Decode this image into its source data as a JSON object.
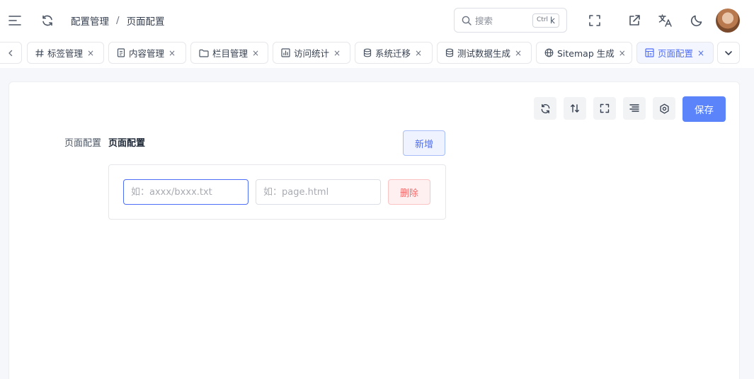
{
  "header": {
    "breadcrumb": [
      "配置管理",
      "页面配置"
    ],
    "breadcrumb_separator": "/",
    "search": {
      "placeholder": "搜索",
      "shortcut_ctrl": "Ctrl",
      "shortcut_key": "k"
    },
    "icons": {
      "menu": "menu-toggle-icon",
      "refresh": "refresh-icon",
      "fullscreen": "fullscreen-icon",
      "external": "external-link-icon",
      "translate": "translate-icon",
      "theme": "moon-icon"
    }
  },
  "tabs": {
    "items": [
      {
        "label": "标签管理",
        "icon": "hash-icon",
        "active": false
      },
      {
        "label": "内容管理",
        "icon": "document-icon",
        "active": false
      },
      {
        "label": "栏目管理",
        "icon": "folder-icon",
        "active": false
      },
      {
        "label": "访问统计",
        "icon": "bar-chart-icon",
        "active": false
      },
      {
        "label": "系统迁移",
        "icon": "database-icon",
        "active": false
      },
      {
        "label": "测试数据生成",
        "icon": "database-icon",
        "active": false
      },
      {
        "label": "Sitemap 生成",
        "icon": "globe-icon",
        "active": false
      },
      {
        "label": "页面配置",
        "icon": "layout-icon",
        "active": true
      }
    ],
    "close_glyph": "×"
  },
  "main": {
    "toolbar": {
      "save_label": "保存"
    },
    "form": {
      "label": "页面配置",
      "title": "页面配置",
      "add_label": "新增",
      "row": {
        "path_placeholder": "如：axxx/bxxx.txt",
        "page_placeholder": "如：page.html",
        "delete_label": "删除"
      }
    }
  },
  "colors": {
    "primary": "#5b84fb",
    "active_tab": "#4f6ef7",
    "danger": "#f56c6c",
    "danger_bg": "#fef0f0"
  }
}
